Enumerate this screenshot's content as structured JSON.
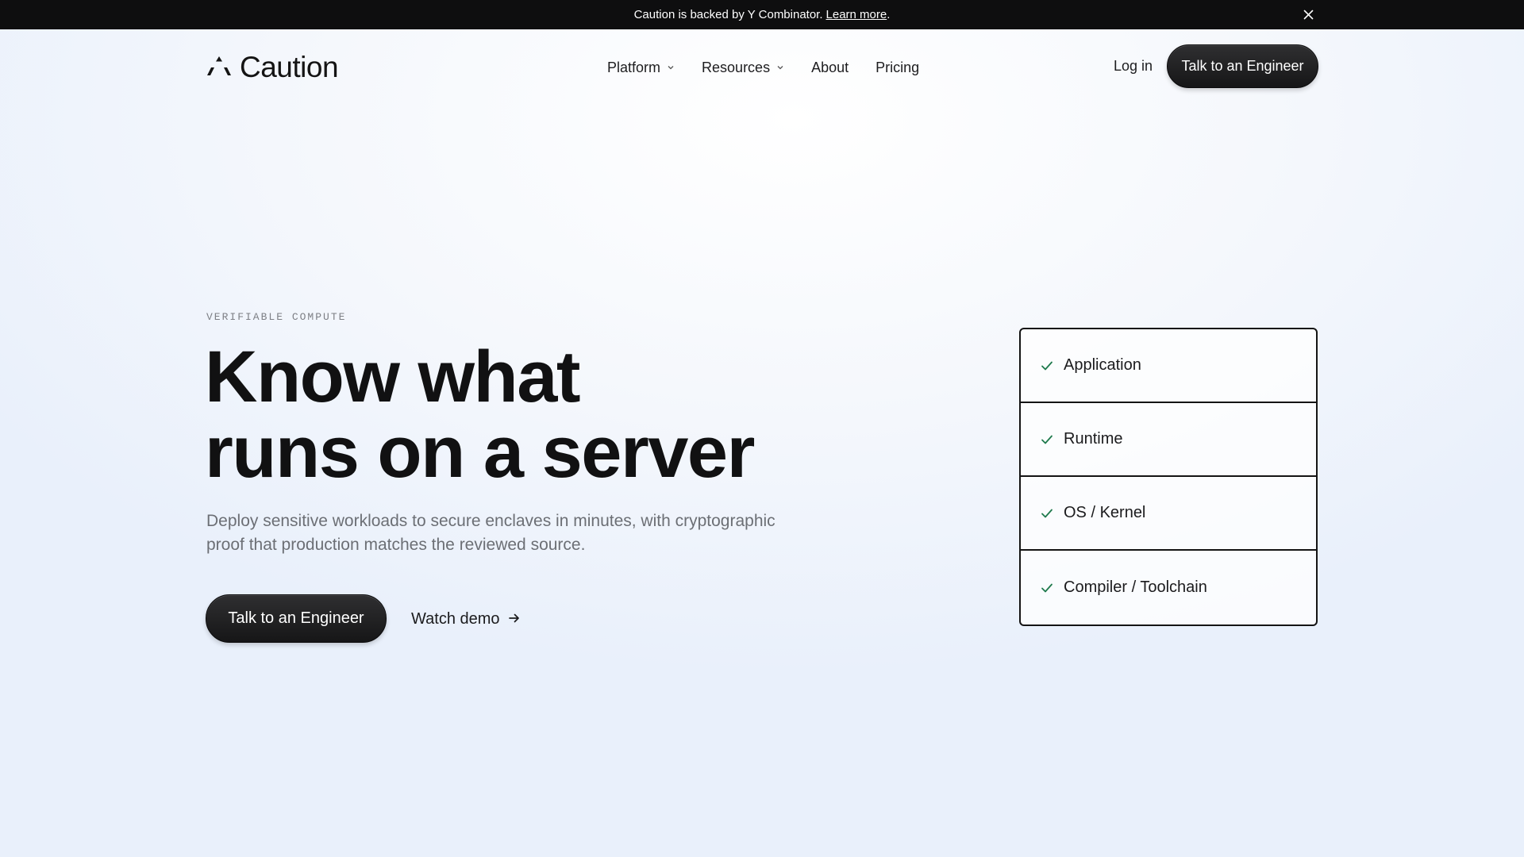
{
  "announcement": {
    "text": "Caution is backed by Y Combinator.",
    "link_label": "Learn more",
    "suffix": ".",
    "close_icon": "close-icon"
  },
  "nav": {
    "brand": "Caution",
    "brand_icon": "triangle-logo-icon",
    "links": [
      {
        "label": "Platform",
        "has_dropdown": true
      },
      {
        "label": "Resources",
        "has_dropdown": true
      },
      {
        "label": "About",
        "has_dropdown": false
      },
      {
        "label": "Pricing",
        "has_dropdown": false
      }
    ],
    "login_label": "Log in",
    "cta_label": "Talk to an Engineer"
  },
  "hero": {
    "eyebrow": "VERIFIABLE COMPUTE",
    "headline_line1": "Know what",
    "headline_line2": "runs on a server",
    "subtext": "Deploy sensitive workloads to secure enclaves in minutes, with cryptographic proof that production matches the reviewed source.",
    "cta_label": "Talk to an Engineer",
    "secondary_label": "Watch demo",
    "secondary_icon": "arrow-right-icon"
  },
  "stack": {
    "check_icon": "check-icon",
    "check_color": "#1f7a4d",
    "items": [
      {
        "label": "Application"
      },
      {
        "label": "Runtime"
      },
      {
        "label": "OS / Kernel"
      },
      {
        "label": "Compiler / Toolchain"
      }
    ]
  },
  "colors": {
    "announcement_bg": "#0e0e0f",
    "text_primary": "#141414",
    "text_muted": "#6c6f75",
    "button_dark": "#1a1a1b"
  }
}
